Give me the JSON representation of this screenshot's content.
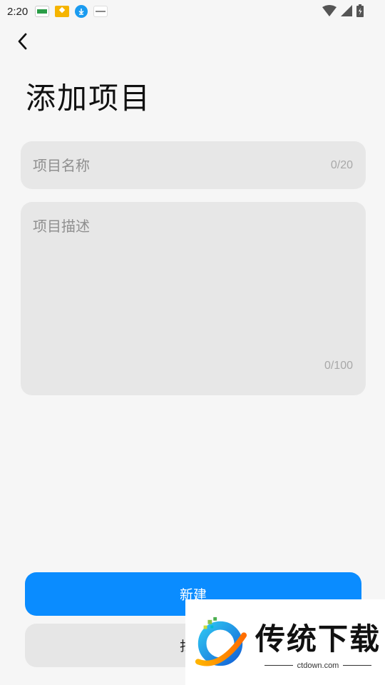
{
  "status_bar": {
    "time": "2:20",
    "notification_icons": [
      "app-icon",
      "app-icon",
      "download-icon",
      "app-icon"
    ],
    "right_icons": [
      "wifi-icon",
      "signal-icon",
      "battery-icon"
    ]
  },
  "header": {
    "back_icon": "chevron-left-icon",
    "title": "添加项目"
  },
  "form": {
    "name_placeholder": "项目名称",
    "name_value": "",
    "name_counter": "0/20",
    "desc_placeholder": "项目描述",
    "desc_value": "",
    "desc_counter": "0/100"
  },
  "actions": {
    "create_label": "新建",
    "scan_label": "扫码"
  },
  "watermark": {
    "title": "传统下载",
    "url": "ctdown.com"
  },
  "colors": {
    "accent": "#0a8cff",
    "background": "#f6f6f6",
    "field_bg": "#e7e7e7"
  }
}
